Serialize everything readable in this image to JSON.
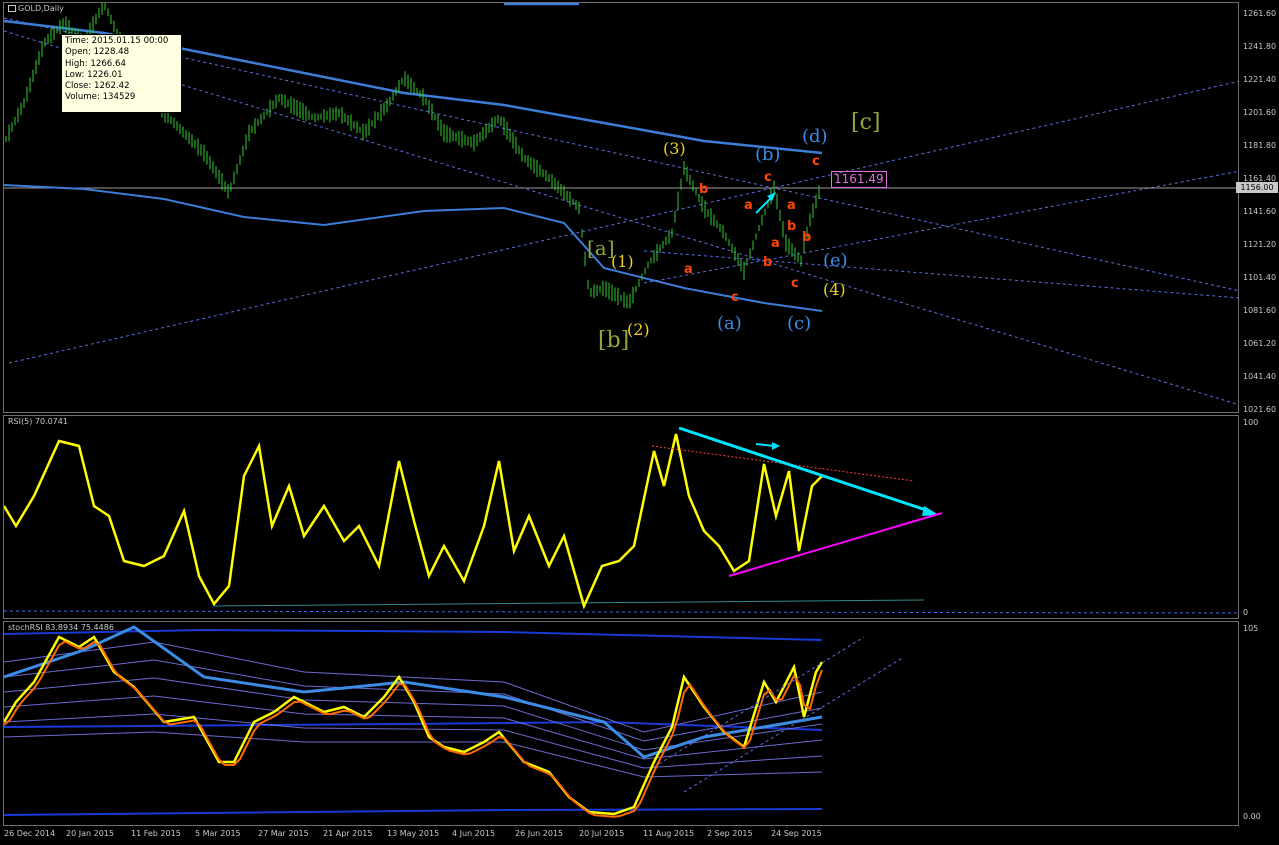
{
  "window": {
    "title": "GOLD,Daily"
  },
  "tooltip": {
    "time": "Time: 2015.01.15 00:00",
    "open": "Open: 1228.48",
    "high": "High: 1266.64",
    "low": "Low: 1226.01",
    "close": "Close: 1262.42",
    "volume": "Volume: 134529"
  },
  "price_scale": [
    "1261.60",
    "1241.80",
    "1221.40",
    "1201.60",
    "1181.80",
    "1161.40",
    "1141.60",
    "1121.20",
    "1101.40",
    "1081.60",
    "1061.20",
    "1041.40",
    "1021.60"
  ],
  "current_price": "1156.00",
  "last_price_box": "1161.49",
  "wave_labels": {
    "a_big": "[a]",
    "b_big": "[b]",
    "c_big": "[c]",
    "w1": "(1)",
    "w2": "(2)",
    "w3": "(3)",
    "w4": "(4)",
    "wa": "(a)",
    "wb": "(b)",
    "wc": "(c)",
    "wd": "(d)",
    "we": "(e)",
    "a": "a",
    "b": "b",
    "c": "c"
  },
  "rsi_panel": {
    "title": "RSI(5) 70.0741",
    "level_top": "100",
    "level_bottom": "0"
  },
  "stoch_panel": {
    "title": "stochRSI 83.8934 75.4486",
    "level_top": "105",
    "level_bottom": "0.00"
  },
  "time_axis": [
    "26 Dec 2014",
    "20 Jan 2015",
    "11 Feb 2015",
    "5 Mar 2015",
    "27 Mar 2015",
    "21 Apr 2015",
    "13 May 2015",
    "4 Jun 2015",
    "26 Jun 2015",
    "20 Jul 2015",
    "11 Aug 2015",
    "2 Sep 2015",
    "24 Sep 2015"
  ],
  "colors": {
    "background": "#000000",
    "candles": "#32cd32",
    "ma_band": "#3c7dd8",
    "trend_lines": "#5a6ee0",
    "rsi_line": "#ffff00",
    "cyan_arrow": "#00e5ff",
    "magenta_line": "#ff00ff",
    "stoch_fast": "#ffff00",
    "stoch_slow": "#ff6a00",
    "wave_green": "#8fa83a",
    "wave_yellow": "#f0d020",
    "wave_blue": "#3c8ce6",
    "wave_red": "#ff4500"
  }
}
